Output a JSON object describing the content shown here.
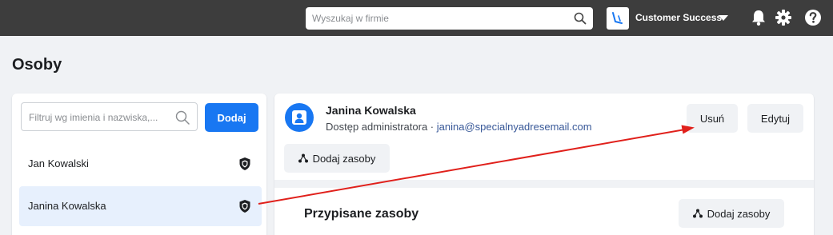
{
  "topbar": {
    "search_placeholder": "Wyszukaj w firmie",
    "business_name": "Customer Success",
    "icons": [
      "search-icon",
      "business-logo-icon",
      "caret-down-icon",
      "bell-icon",
      "gear-icon",
      "help-icon"
    ]
  },
  "page": {
    "title": "Osoby"
  },
  "people": {
    "filter_placeholder": "Filtruj wg imienia i nazwiska,...",
    "add_label": "Dodaj",
    "items": [
      {
        "name": "Jan Kowalski",
        "icon": "shield-icon",
        "selected": false
      },
      {
        "name": "Janina Kowalska",
        "icon": "shield-icon",
        "selected": true
      }
    ]
  },
  "details": {
    "name": "Janina Kowalska",
    "role": "Dostęp administratora",
    "separator": " · ",
    "email": "janina@specialnyadresemail.com",
    "remove_label": "Usuń",
    "edit_label": "Edytuj",
    "add_assets_label": "Dodaj zasoby",
    "assigned_title": "Przypisane zasoby",
    "assigned_add_label": "Dodaj zasoby"
  },
  "colors": {
    "topbar": "#3d3d3d",
    "accent": "#1877f2",
    "selected_row": "#e7f0fd",
    "link": "#385898",
    "annotation_arrow": "#e0201b"
  }
}
